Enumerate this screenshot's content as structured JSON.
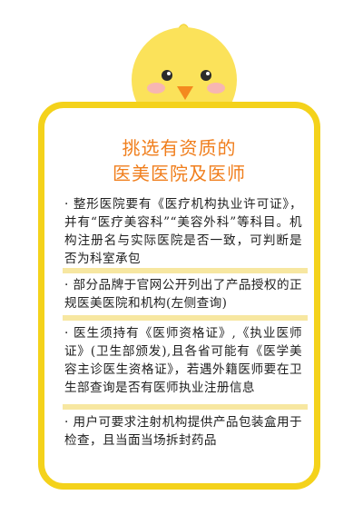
{
  "title": {
    "line1": "挑选有资质的",
    "line2": "医美医院及医师"
  },
  "items": [
    "· 整形医院要有《医疗机构执业许可证》，并有“医疗美容科”“美容外科”等科目。机构注册名与实际医院是否一致，可判断是否为科室承包",
    "· 部分品牌于官网公开列出了产品授权的正规医美医院和机构(左侧查询)",
    "· 医生须持有《医师资格证》,《执业医师证》(卫生部颁发),且各省可能有《医学美容主诊医生资格证》，若遇外籍医师要在卫生部查询是否有医师执业注册信息",
    "· 用户可要求注射机构提供产品包装盒用于检查，且当面当场拆封药品"
  ],
  "colors": {
    "border": "#f4d21b",
    "title": "#f07e1c",
    "separator": "#f7e7a1",
    "chick": "#fbe25a",
    "beak": "#f48a1e"
  },
  "icons": {
    "mascot": "chick-mascot-icon"
  }
}
